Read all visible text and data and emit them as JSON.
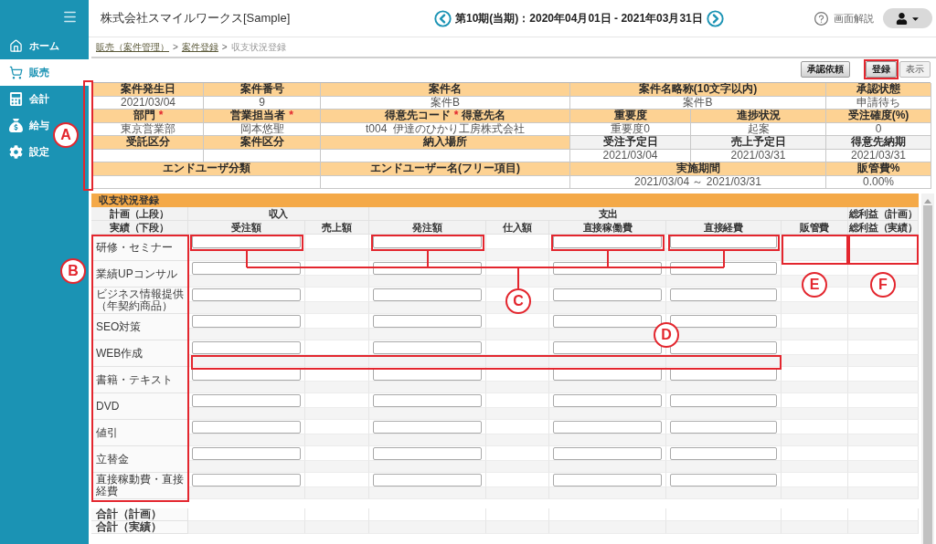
{
  "sidebar": {
    "items": [
      {
        "label": "ホーム",
        "selected": false
      },
      {
        "label": "販売",
        "selected": true
      },
      {
        "label": "会計",
        "selected": false
      },
      {
        "label": "給与",
        "selected": false
      },
      {
        "label": "設定",
        "selected": false
      }
    ]
  },
  "header": {
    "company": "株式会社スマイルワークス[Sample]",
    "period": "第10期(当期)：2020年04月01日 - 2021年03月31日",
    "help": "画面解説"
  },
  "breadcrumb": [
    {
      "label": "販売（案件管理）",
      "kind": "link"
    },
    {
      "label": ">",
      "kind": "separator"
    },
    {
      "label": "案件登録",
      "kind": "link"
    },
    {
      "label": ">",
      "kind": "separator"
    },
    {
      "label": "収支状況登録",
      "kind": "current"
    }
  ],
  "actions": [
    {
      "label": "承認依頼",
      "kind": "action",
      "highlighted": false
    },
    {
      "label": "登録",
      "kind": "action",
      "highlighted": true
    },
    {
      "label": "表示",
      "kind": "plain",
      "highlighted": false
    }
  ],
  "case_info": {
    "rows": [
      [
        {
          "kind": "label",
          "text": "案件発生日"
        },
        {
          "kind": "label",
          "text": "案件番号"
        },
        {
          "kind": "label",
          "text": "案件名"
        },
        {
          "kind": "label",
          "text": "案件名略称(10文字以内)"
        },
        {
          "kind": "merged"
        },
        {
          "kind": "label",
          "text": "承認状態"
        }
      ],
      [
        {
          "kind": "value",
          "text": "2021/03/04"
        },
        {
          "kind": "value",
          "text": "9"
        },
        {
          "kind": "value",
          "text": "案件B"
        },
        {
          "kind": "value",
          "text": "案件B"
        },
        {
          "kind": "merged"
        },
        {
          "kind": "value",
          "text": "申請待ち"
        }
      ],
      [
        {
          "kind": "label",
          "text": "部門",
          "required_mark": "*"
        },
        {
          "kind": "label",
          "text": "営業担当者",
          "required_mark": "*"
        },
        {
          "kind": "label",
          "text": "得意先コード",
          "required_mark": "*",
          "text_after": "得意先名"
        },
        {
          "kind": "label",
          "text": "重要度"
        },
        {
          "kind": "label",
          "text": "進捗状況"
        },
        {
          "kind": "label",
          "text": "受注確度(%)"
        }
      ],
      [
        {
          "kind": "value",
          "text": "東京営業部"
        },
        {
          "kind": "value",
          "text": "岡本悠聖"
        },
        {
          "kind": "value",
          "text": "t004  伊達のひかり工房株式会社"
        },
        {
          "kind": "value",
          "text": "重要度0"
        },
        {
          "kind": "value",
          "text": "起案"
        },
        {
          "kind": "value",
          "text": "0"
        }
      ],
      [
        {
          "kind": "label",
          "text": "受託区分"
        },
        {
          "kind": "label",
          "text": "案件区分"
        },
        {
          "kind": "label",
          "text": "納入場所"
        },
        {
          "kind": "sublabel",
          "text": "受注予定日"
        },
        {
          "kind": "sublabel",
          "text": "売上予定日"
        },
        {
          "kind": "sublabel",
          "text": "得意先納期"
        }
      ],
      [
        {
          "kind": "value"
        },
        {
          "kind": "value"
        },
        {
          "kind": "value"
        },
        {
          "kind": "value",
          "text": "2021/03/04"
        },
        {
          "kind": "value",
          "text": "2021/03/31"
        },
        {
          "kind": "value",
          "text": "2021/03/31"
        }
      ],
      [
        {
          "kind": "label",
          "text": "エンドユーザ分類"
        },
        {
          "kind": "merged"
        },
        {
          "kind": "label",
          "text": "エンドユーザー名(フリー項目)"
        },
        {
          "kind": "label",
          "text": "実施期間"
        },
        {
          "kind": "merged"
        },
        {
          "kind": "label",
          "text": "販管費%"
        }
      ],
      [
        {
          "kind": "value"
        },
        {
          "kind": "merged"
        },
        {
          "kind": "value"
        },
        {
          "kind": "value",
          "text": "2021/03/04 ～ 2021/03/31"
        },
        {
          "kind": "merged"
        },
        {
          "kind": "value",
          "text": "0.00%"
        }
      ]
    ]
  },
  "income_table": {
    "title": "収支状況登録",
    "group_headers": [
      {
        "kind": "header",
        "text": "計画（上段）"
      },
      {
        "kind": "header",
        "text": "収入"
      },
      {
        "kind": "merged"
      },
      {
        "kind": "header",
        "text": "支出"
      },
      {
        "kind": "merged"
      },
      {
        "kind": "merged"
      },
      {
        "kind": "merged"
      },
      {
        "kind": "merged"
      },
      {
        "kind": "header",
        "text": "総利益（計画）"
      }
    ],
    "columns": [
      {
        "header": "実績（下段）",
        "kind": "label"
      },
      {
        "header": "受注額",
        "kind": "input"
      },
      {
        "header": "売上額",
        "kind": "blank"
      },
      {
        "header": "発注額",
        "kind": "input"
      },
      {
        "header": "仕入額",
        "kind": "blank"
      },
      {
        "header": "直接稼働費",
        "kind": "input"
      },
      {
        "header": "直接経費",
        "kind": "input"
      },
      {
        "header": "販管費",
        "kind": "blank"
      },
      {
        "header": "総利益（実績）",
        "kind": "blank"
      }
    ],
    "categories": [
      {
        "label": "研修・セミナー"
      },
      {
        "label": "業績UPコンサル"
      },
      {
        "label": "ビジネス情報提供（年契約商品）"
      },
      {
        "label": "SEO対策"
      },
      {
        "label": "WEB作成"
      },
      {
        "label": "書籍・テキスト"
      },
      {
        "label": "DVD"
      },
      {
        "label": "値引"
      },
      {
        "label": "立替金"
      },
      {
        "label": "直接稼動費・直接経費"
      }
    ],
    "totals": [
      {
        "label": "合計（計画）"
      },
      {
        "label": "合計（実績）"
      }
    ]
  },
  "annotations": [
    {
      "label": "A"
    },
    {
      "label": "B"
    },
    {
      "label": "C"
    },
    {
      "label": "D"
    },
    {
      "label": "E"
    },
    {
      "label": "F"
    }
  ]
}
